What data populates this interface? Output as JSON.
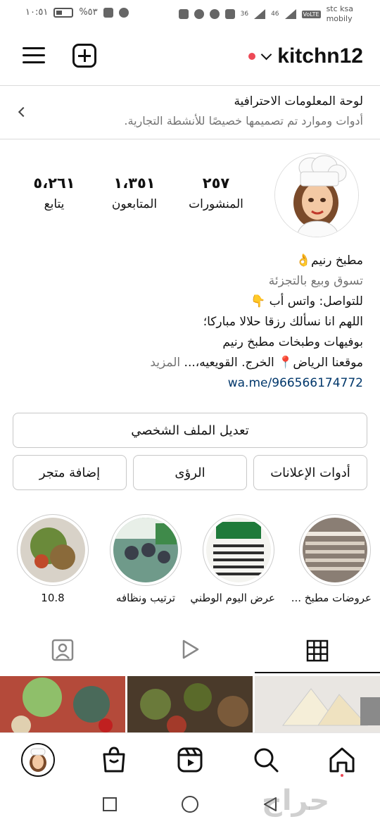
{
  "status_bar": {
    "time": "١٠:٥١",
    "battery": "%٥٣",
    "carrier_line1": "stc ksa",
    "carrier_line2": "mobily",
    "volte": "VoLTE",
    "signal1": "36",
    "signal2": "46"
  },
  "header": {
    "username": "kitchn12"
  },
  "dashboard": {
    "title": "لوحة المعلومات الاحترافية",
    "subtitle": "أدوات وموارد تم تصميمها خصيصًا للأنشطة التجارية."
  },
  "stats": {
    "posts": {
      "value": "٢٥٧",
      "label": "المنشورات"
    },
    "followers": {
      "value": "١،٣٥١",
      "label": "المتابعون"
    },
    "following": {
      "value": "٥،٢٦١",
      "label": "يتابع"
    }
  },
  "bio": {
    "name": "مطبخ رنيم👌",
    "category": "تسوق وبيع بالتجزئة",
    "line1": "للتواصل: واتس أب 👇",
    "line2": "اللهم انا نسألك رزقا حلالا مباركا؛",
    "line3": "بوفيهات وطبخات مطبخ رنيم",
    "line4": "موقعنا الرياض📍 الخرج. القويعيه،...",
    "more": "المزيد",
    "link": "wa.me/966566174772"
  },
  "buttons": {
    "edit_profile": "تعديل الملف الشخصي",
    "ad_tools": "أدوات الإعلانات",
    "insights": "الرؤى",
    "add_shop": "إضافة متجر"
  },
  "highlights": [
    {
      "label": "عروضات مطبخ ..."
    },
    {
      "label": "عرض اليوم الوطني"
    },
    {
      "label": "ترتيب ونظافه"
    },
    {
      "label": "10.8"
    }
  ],
  "colors": {
    "accent_red": "#ed4956",
    "link": "#00376b",
    "muted": "#737373",
    "border": "#c7c7c7"
  },
  "watermark": "حراج"
}
